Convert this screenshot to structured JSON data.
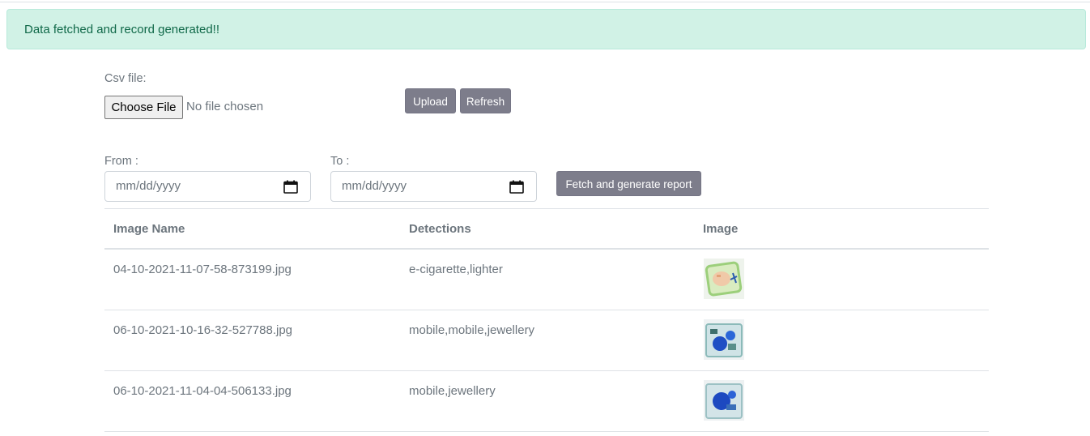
{
  "alert": {
    "message": "Data fetched and record generated!!"
  },
  "upload": {
    "label": "Csv file:",
    "choose_button": "Choose File",
    "file_status": "No file chosen",
    "upload_button": "Upload",
    "refresh_button": "Refresh"
  },
  "report": {
    "from_label": "From :",
    "to_label": "To :",
    "from_placeholder": "mm/dd/yyyy",
    "to_placeholder": "mm/dd/yyyy",
    "fetch_button": "Fetch and generate report"
  },
  "table": {
    "headers": [
      "Image Name",
      "Detections",
      "Image"
    ],
    "rows": [
      {
        "image_name": "04-10-2021-11-07-58-873199.jpg",
        "detections": "e-cigarette,lighter",
        "thumb_icon": "xray-thumbnail-icon"
      },
      {
        "image_name": "06-10-2021-10-16-32-527788.jpg",
        "detections": "mobile,mobile,jewellery",
        "thumb_icon": "xray-thumbnail-icon"
      },
      {
        "image_name": "06-10-2021-11-04-04-506133.jpg",
        "detections": "mobile,jewellery",
        "thumb_icon": "xray-thumbnail-icon"
      }
    ]
  },
  "colors": {
    "alert_bg": "#d1f2e6",
    "alert_text": "#0f6848",
    "button_bg": "#7d7d8b",
    "text_muted": "#6c757d"
  }
}
